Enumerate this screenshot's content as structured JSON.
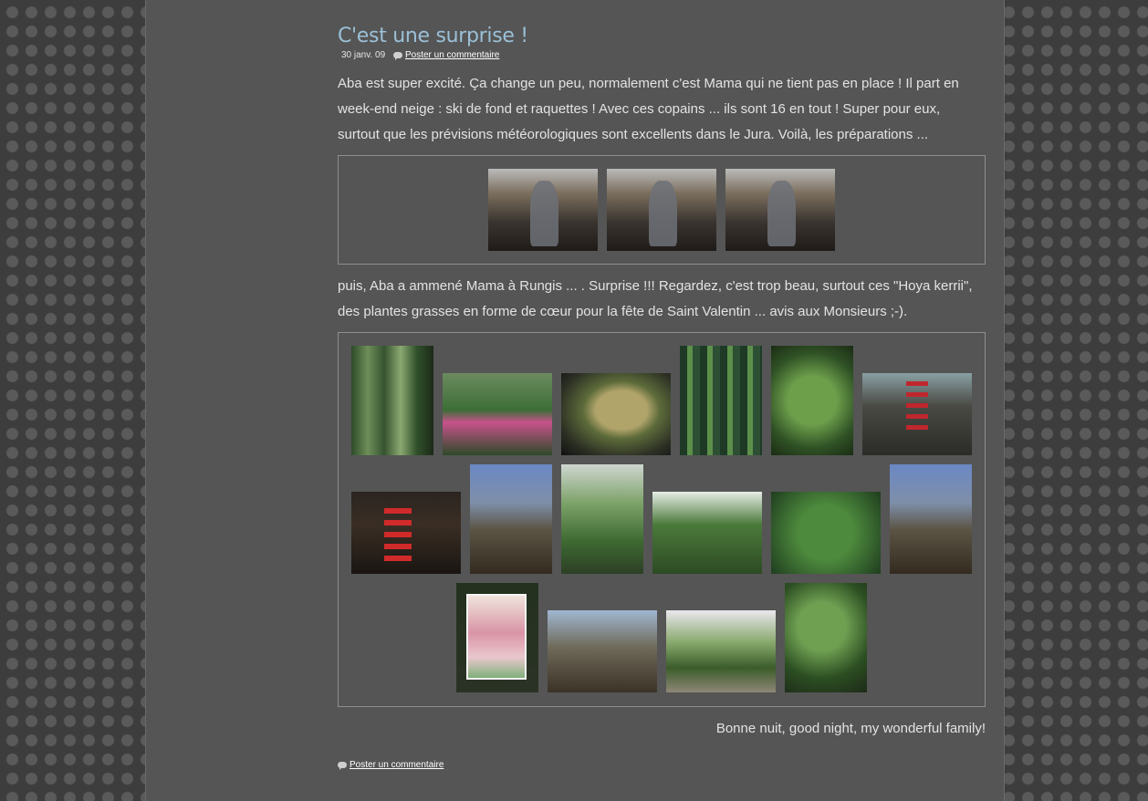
{
  "post": {
    "title": "C'est une surprise !",
    "date": "30 janv. 09",
    "comment_link": "Poster un commentaire",
    "paragraph_1": "Aba est super excité. Ça change un peu, normalement c'est Mama qui ne tient pas en place ! Il part en week-end neige : ski de fond et raquettes ! Avec ces copains ... ils sont 16 en tout ! Super pour eux, surtout que les prévisions météorologiques sont excellents dans le Jura. Voilà, les préparations ...",
    "paragraph_2": "puis, Aba a ammené Mama à Rungis ... . Surprise !!! Regardez, c'est trop beau, surtout ces \"Hoya kerrii\", des plantes grasses en forme de cœur pour la fête de Saint Valentin ... avis aux Monsieurs ;-).",
    "closing": "Bonne nuit, good night, my wonderful family!",
    "footer_comment_link": "Poster un commentaire"
  },
  "icons": {
    "comment": "speech-bubble-icon"
  },
  "colors": {
    "page_bg": "#555555",
    "outer_bg": "#3d3d3d",
    "title": "#9bc0d8",
    "text": "#e3e3e3",
    "gallery_border": "#8e8e8e"
  }
}
